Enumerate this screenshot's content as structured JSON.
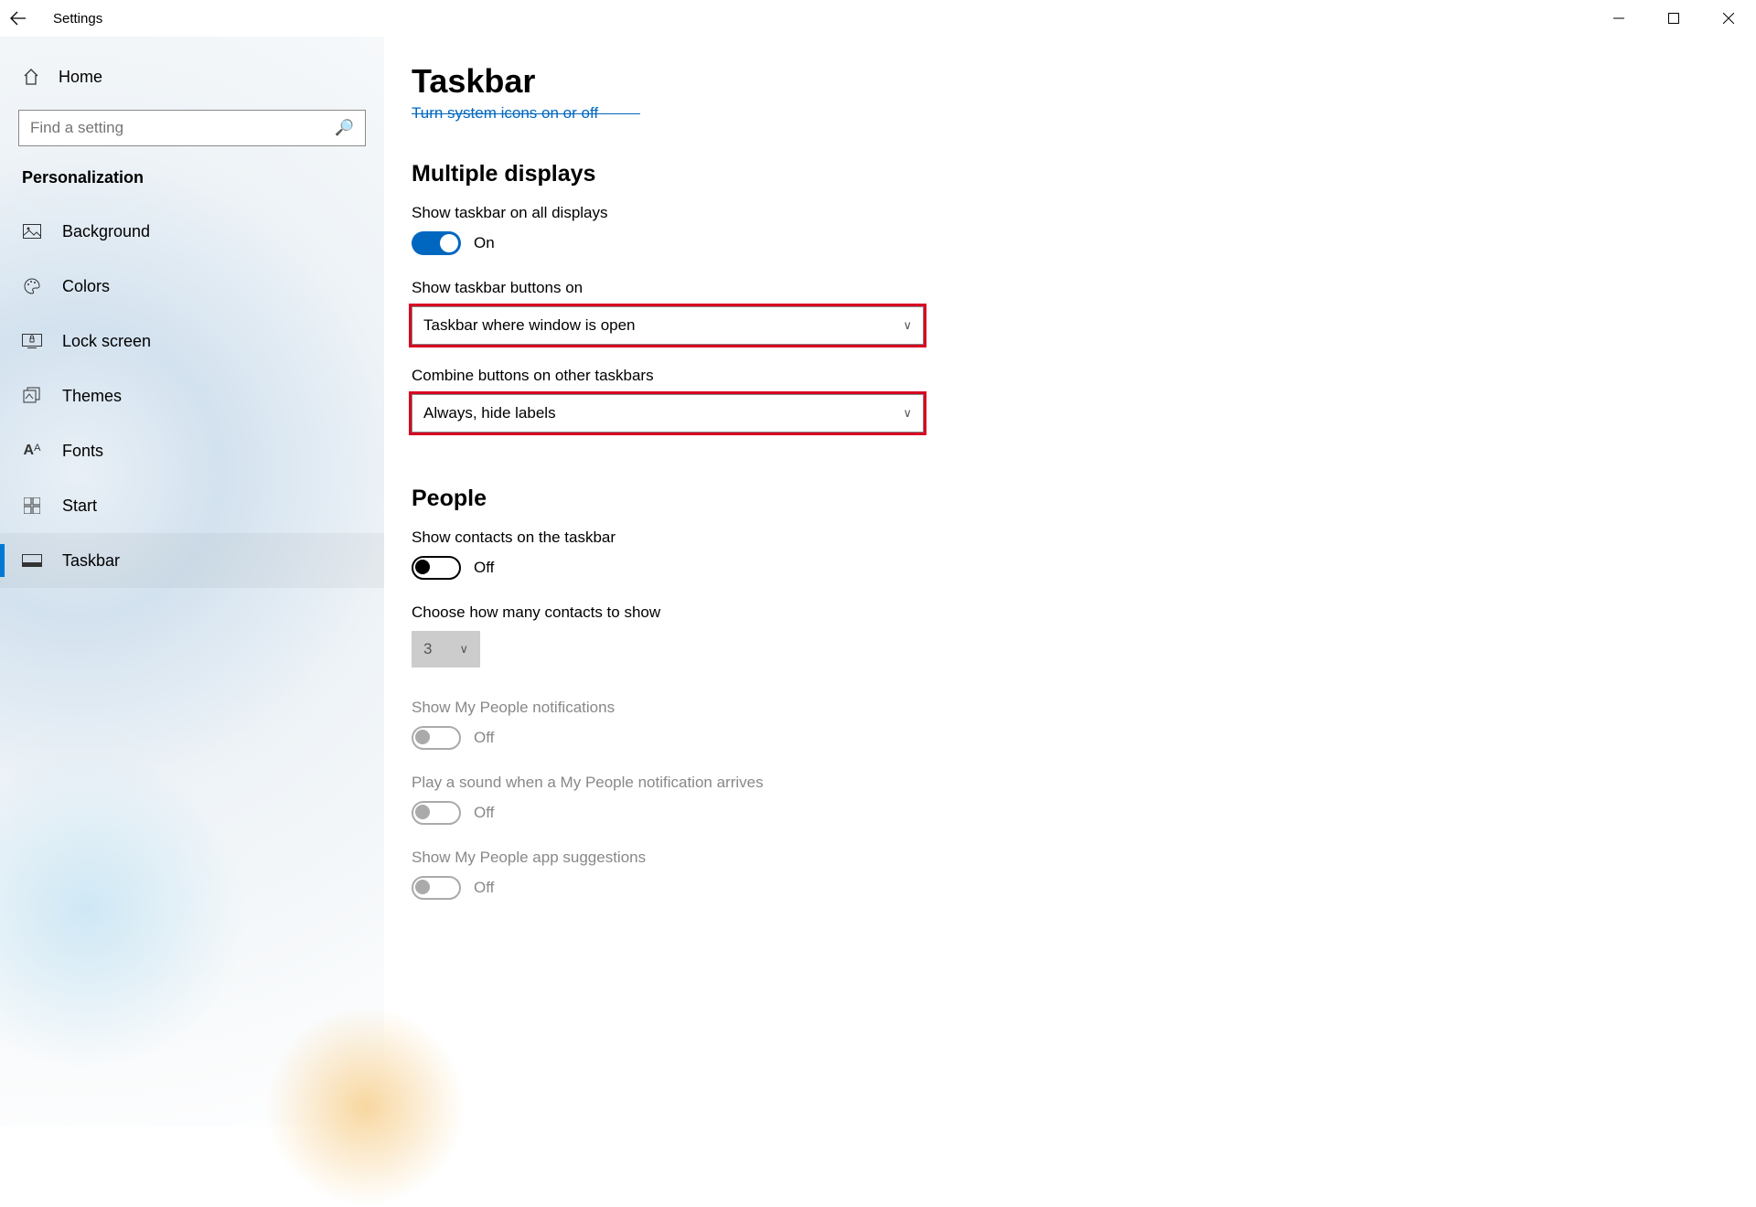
{
  "window": {
    "title": "Settings"
  },
  "sidebar": {
    "home": "Home",
    "search_placeholder": "Find a setting",
    "section": "Personalization",
    "items": [
      {
        "label": "Background"
      },
      {
        "label": "Colors"
      },
      {
        "label": "Lock screen"
      },
      {
        "label": "Themes"
      },
      {
        "label": "Fonts"
      },
      {
        "label": "Start"
      },
      {
        "label": "Taskbar"
      }
    ]
  },
  "main": {
    "page_title": "Taskbar",
    "clipped_link": "Turn system icons on or off",
    "sections": {
      "multiple_displays": {
        "heading": "Multiple displays",
        "show_all": {
          "label": "Show taskbar on all displays",
          "state": "On"
        },
        "show_buttons": {
          "label": "Show taskbar buttons on",
          "value": "Taskbar where window is open"
        },
        "combine": {
          "label": "Combine buttons on other taskbars",
          "value": "Always, hide labels"
        }
      },
      "people": {
        "heading": "People",
        "show_contacts": {
          "label": "Show contacts on the taskbar",
          "state": "Off"
        },
        "how_many": {
          "label": "Choose how many contacts to show",
          "value": "3"
        },
        "notifications": {
          "label": "Show My People notifications",
          "state": "Off"
        },
        "sound": {
          "label": "Play a sound when a My People notification arrives",
          "state": "Off"
        },
        "suggestions": {
          "label": "Show My People app suggestions",
          "state": "Off"
        }
      }
    }
  }
}
